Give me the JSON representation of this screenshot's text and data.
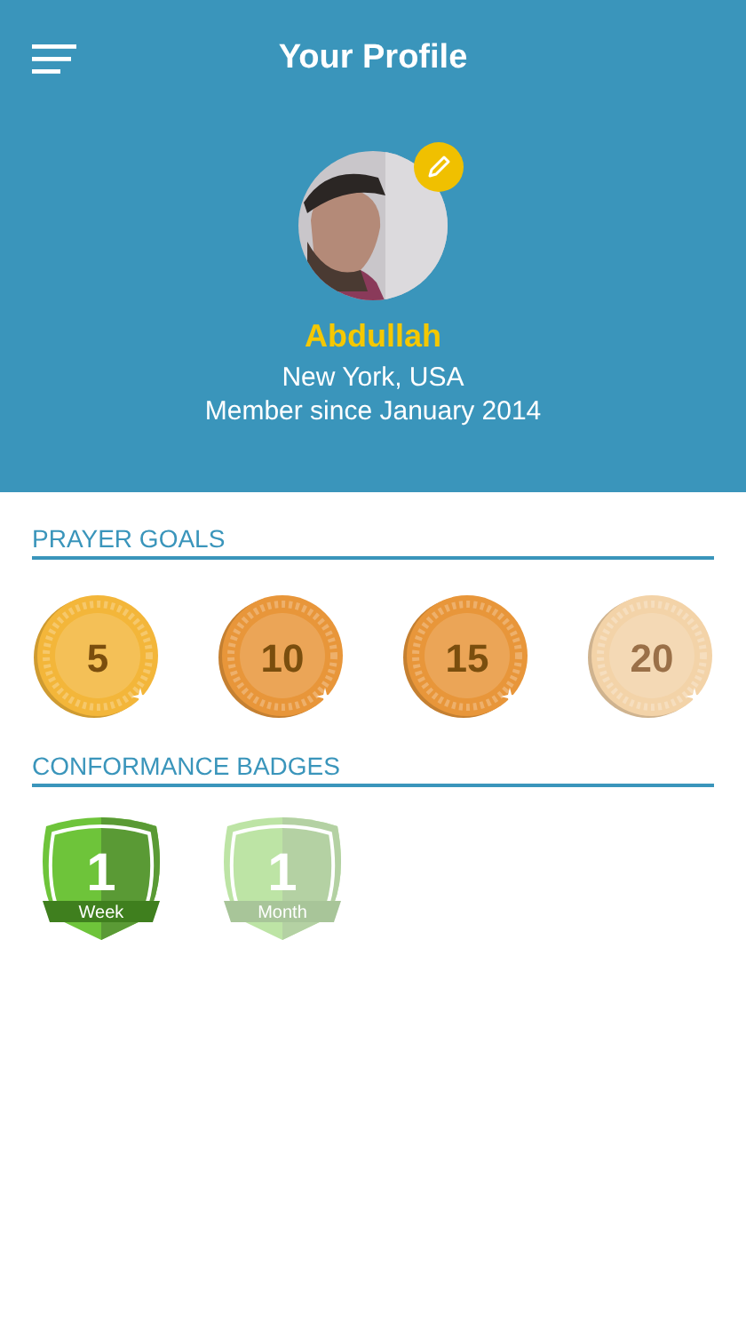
{
  "header": {
    "title": "Your Profile"
  },
  "profile": {
    "name": "Abdullah",
    "location": "New York, USA",
    "member_since": "Member since January 2014"
  },
  "prayer_goals": {
    "title": "PRAYER GOALS",
    "coins": [
      {
        "label": "5",
        "color": "#f3b63a",
        "earned": true
      },
      {
        "label": "10",
        "color": "#e8963a",
        "earned": true
      },
      {
        "label": "15",
        "color": "#e8963a",
        "earned": true
      },
      {
        "label": "20",
        "color": "#f3d3a8",
        "earned": false
      }
    ]
  },
  "conformance_badges": {
    "title": "CONFORMANCE BADGES",
    "badges": [
      {
        "number": "1",
        "label": "Week",
        "earned": true
      },
      {
        "number": "1",
        "label": "Month",
        "earned": false
      }
    ]
  }
}
